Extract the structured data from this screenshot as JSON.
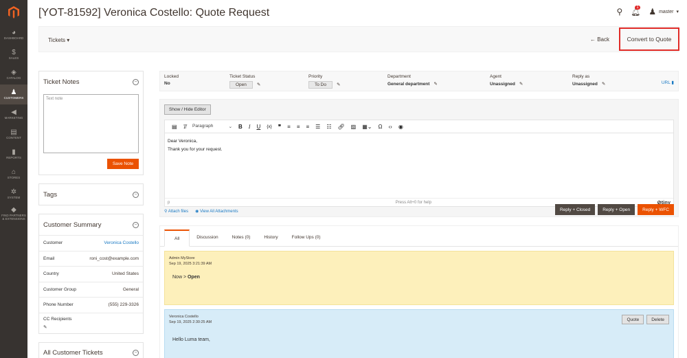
{
  "nav": {
    "items": [
      {
        "icon": "dashboard-icon",
        "glyph": "◕",
        "label": "DASHBOARD"
      },
      {
        "icon": "dollar-icon",
        "glyph": "$",
        "label": "SALES"
      },
      {
        "icon": "box-icon",
        "glyph": "◈",
        "label": "CATALOG"
      },
      {
        "icon": "person-icon",
        "glyph": "♟",
        "label": "CUSTOMERS"
      },
      {
        "icon": "megaphone-icon",
        "glyph": "◀",
        "label": "MARKETING"
      },
      {
        "icon": "content-icon",
        "glyph": "▤",
        "label": "CONTENT"
      },
      {
        "icon": "bar-chart-icon",
        "glyph": "▮",
        "label": "REPORTS"
      },
      {
        "icon": "store-icon",
        "glyph": "⌂",
        "label": "STORES"
      },
      {
        "icon": "gear-icon",
        "glyph": "✲",
        "label": "SYSTEM"
      },
      {
        "icon": "partners-icon",
        "glyph": "◆",
        "label": "FIND PARTNERS & EXTENSIONS"
      }
    ]
  },
  "header": {
    "title": "[YOT-81592] Veronica Costello: Quote Request",
    "notifications": "1",
    "user": "master"
  },
  "actionbar": {
    "scope": "Tickets ▾",
    "back": "← Back",
    "convert": "Convert to Quote"
  },
  "notes": {
    "title": "Ticket Notes",
    "placeholder": "Text note",
    "save": "Save Note"
  },
  "tags": {
    "title": "Tags"
  },
  "customer": {
    "title": "Customer Summary",
    "rows": [
      {
        "label": "Customer",
        "value": "Veronica Costello"
      },
      {
        "label": "Email",
        "value": "roni_cost@example.com"
      },
      {
        "label": "Country",
        "value": "United States"
      },
      {
        "label": "Customer Group",
        "value": "General"
      },
      {
        "label": "Phone Number",
        "value": "(555) 229-3326"
      }
    ],
    "cc_label": "CC Recipients"
  },
  "all_tickets": {
    "title": "All Customer Tickets"
  },
  "meta": {
    "locked_label": "Locked",
    "locked_value": "No",
    "status_label": "Ticket Status",
    "status_value": "Open",
    "priority_label": "Priority",
    "priority_value": "To Do",
    "department_label": "Department",
    "department_value": "General department",
    "agent_label": "Agent",
    "agent_value": "Unassigned",
    "reply_label": "Reply as",
    "reply_value": "Unassigned",
    "url": "URL"
  },
  "editor": {
    "toggle": "Show / Hide Editor",
    "format": "Paragraph",
    "line1": "Dear Veronica,",
    "line2": "Thank you for your request.",
    "path": "p",
    "help": "Press Alt+0 for help",
    "brand": "tiny",
    "attach": "Attach files",
    "view_attach": "View All Attachments",
    "reply_closed": "Reply + Closed",
    "reply_open": "Reply + Open",
    "reply_wfc": "Reply + WFC"
  },
  "tabs": [
    "All",
    "Discussion",
    "Notes (0)",
    "History",
    "Follow Ups (0)"
  ],
  "messages": [
    {
      "author": "Admin MyStore",
      "date": "Sep 19, 2025 3:21:39 AM",
      "prefix": "Now > ",
      "body": "Open"
    },
    {
      "author": "Veronica Costello",
      "date": "Sep 19, 2025 2:30:25 AM",
      "body": "Hello Luma team,",
      "quote": "Quote",
      "delete": "Delete"
    }
  ]
}
